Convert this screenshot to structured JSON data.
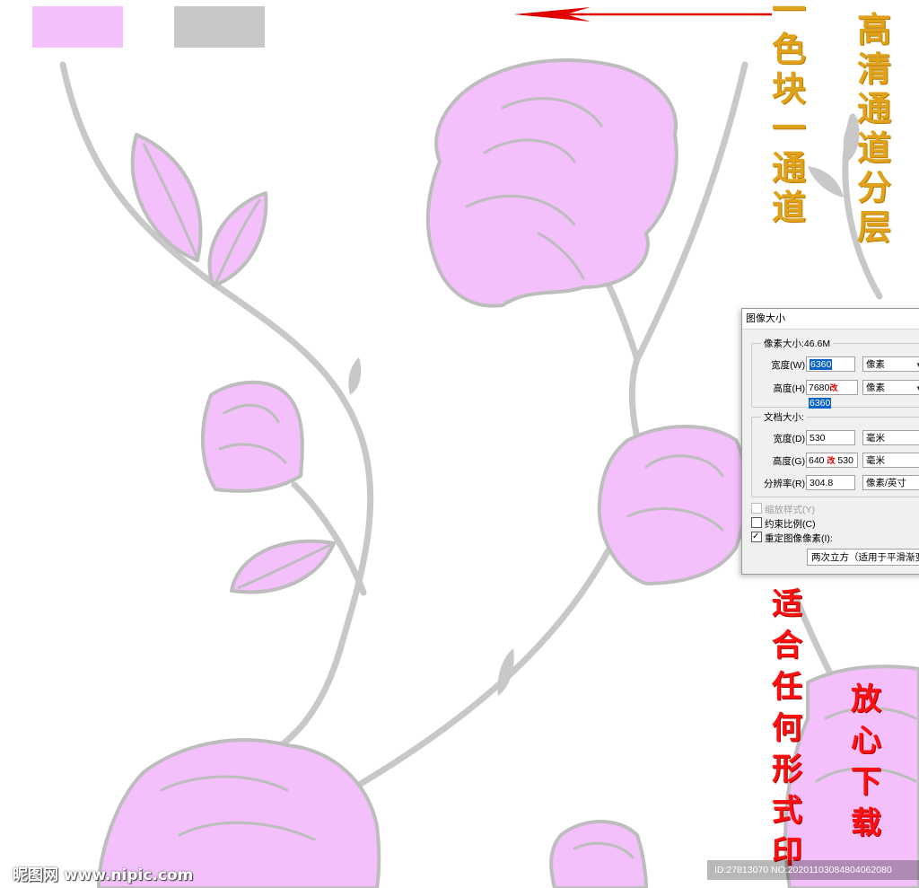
{
  "swatches": [
    {
      "name": "pink-swatch",
      "color": "#f3c0fb"
    },
    {
      "name": "gray-swatch",
      "color": "#c8c8c8"
    }
  ],
  "colors": {
    "flower": "#f3c0fb",
    "stroke": "#bdbdbd",
    "stem": "#c8c8c8",
    "arrow": "#e00000",
    "gold": "#e0a21a",
    "red": "#ff1010"
  },
  "annotations": {
    "one_channel": [
      "一",
      "色",
      "块",
      "一",
      "通",
      "道"
    ],
    "hd_layers": [
      "高",
      "清",
      "通",
      "道",
      "分",
      "层"
    ],
    "any_print": [
      "适",
      "合",
      "任",
      "何",
      "形",
      "式",
      "印"
    ],
    "download": [
      "放",
      "心",
      "下",
      "载"
    ]
  },
  "dialog": {
    "title": "图像大小",
    "pixel_dimensions": "像素大小:46.6M",
    "width_label": "宽度(W):",
    "width_value": "6360",
    "height_label": "高度(H):",
    "height_old": "7680",
    "height_mark": "改",
    "height_new": "6360",
    "pixel_unit": "像素",
    "document_size": "文档大小:",
    "doc_width_label": "宽度(D):",
    "doc_width_value": "530",
    "doc_height_label": "高度(G):",
    "doc_height_old": "640",
    "doc_height_mark": "改",
    "doc_height_new": "530",
    "mm_unit": "毫米",
    "resolution_label": "分辨率(R):",
    "resolution_value": "304.8",
    "resolution_unit": "像素/英寸",
    "scale_styles": "缩放样式(Y)",
    "constrain": "约束比例(C)",
    "resample": "重定图像像素(I):",
    "resample_method": "两次立方（适用于平滑渐变"
  },
  "watermark_left": "昵图网 www.nipic.com",
  "watermark_right": "ID:27813070 NO:20201103084804062080"
}
